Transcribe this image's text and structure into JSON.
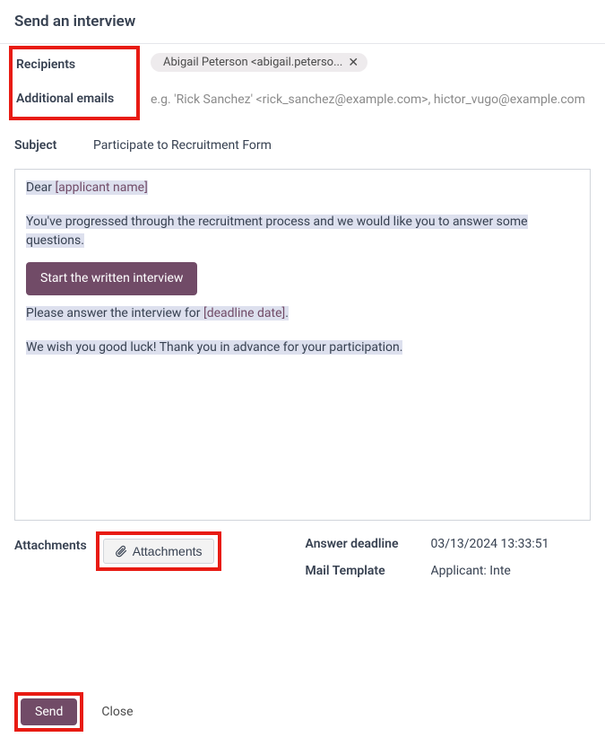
{
  "header": {
    "title": "Send an interview"
  },
  "labels": {
    "recipients": "Recipients",
    "additional_emails": "Additional emails",
    "subject": "Subject",
    "attachments": "Attachments",
    "answer_deadline": "Answer deadline",
    "mail_template": "Mail Template"
  },
  "recipients": {
    "chip": "Abigail Peterson <abigail.peterso...",
    "remove_glyph": "✕"
  },
  "additional_emails": {
    "placeholder": "e.g.  'Rick Sanchez' <rick_sanchez@example.com>, hictor_vugo@example.com"
  },
  "subject": {
    "value": "Participate to Recruitment Form"
  },
  "body": {
    "greeting_prefix": "Dear ",
    "applicant_token": "[applicant name]",
    "para1": "You've progressed through the recruitment process and we would like you to answer some questions.",
    "cta": "Start the written interview",
    "para2_prefix": "Please answer the interview for ",
    "deadline_token": "[deadline date]",
    "para2_suffix": ".",
    "para3": "We wish you good luck! Thank you in advance for your participation."
  },
  "attachments": {
    "button_label": "Attachments"
  },
  "answer_deadline": {
    "value": "03/13/2024 13:33:51"
  },
  "mail_template": {
    "value": "Applicant: Inte"
  },
  "footer": {
    "send": "Send",
    "close": "Close"
  }
}
